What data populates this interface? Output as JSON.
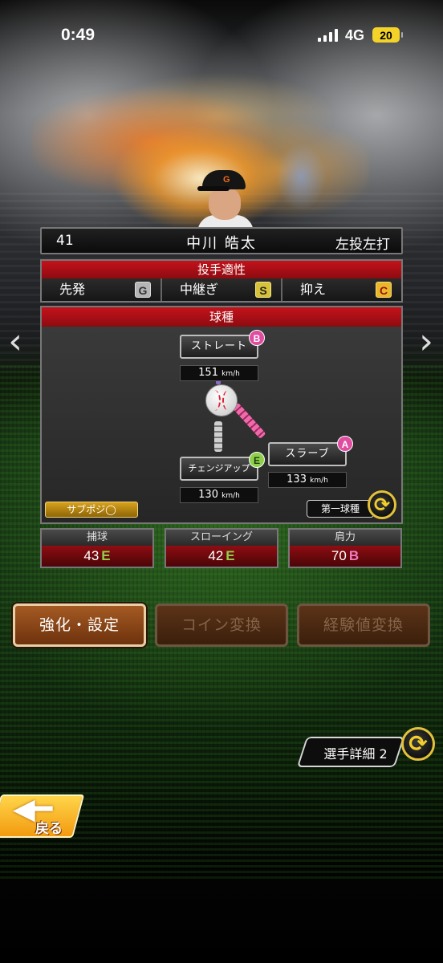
{
  "status_bar": {
    "time": "0:49",
    "network": "4G",
    "battery": "20"
  },
  "player": {
    "number": "41",
    "name": "中川 皓太",
    "handedness": "左投左打"
  },
  "aptitude": {
    "header": "投手適性",
    "roles": [
      {
        "label": "先発",
        "grade": "G"
      },
      {
        "label": "中継ぎ",
        "grade": "S"
      },
      {
        "label": "抑え",
        "grade": "C"
      }
    ]
  },
  "pitches": {
    "header": "球種",
    "items": [
      {
        "name": "ストレート",
        "grade": "B",
        "speed": "151",
        "unit": "km/h"
      },
      {
        "name": "スラーブ",
        "grade": "A",
        "speed": "133",
        "unit": "km/h"
      },
      {
        "name": "チェンジアップ",
        "grade": "E",
        "speed": "130",
        "unit": "km/h"
      }
    ],
    "sub_position": "サブポジ◯",
    "first_pitch_label": "第一球種"
  },
  "stats": [
    {
      "label": "捕球",
      "value": "43",
      "grade": "E"
    },
    {
      "label": "スローイング",
      "value": "42",
      "grade": "E"
    },
    {
      "label": "肩力",
      "value": "70",
      "grade": "B"
    }
  ],
  "actions": {
    "enhance": "強化・設定",
    "coin_exchange": "コイン変換",
    "exp_exchange": "経験値変換"
  },
  "detail_tab_label": "選手詳細 2",
  "back_label": "戻る",
  "icons": {
    "nav_left": "chevron-left-icon",
    "nav_right": "chevron-right-icon",
    "swap": "swap-icon",
    "back": "back-arrow-icon"
  },
  "colors": {
    "header_red": "#c4121b",
    "grade_green": "#8fd04a",
    "grade_pink": "#e04ca0",
    "button_brown": "#a45a23"
  }
}
